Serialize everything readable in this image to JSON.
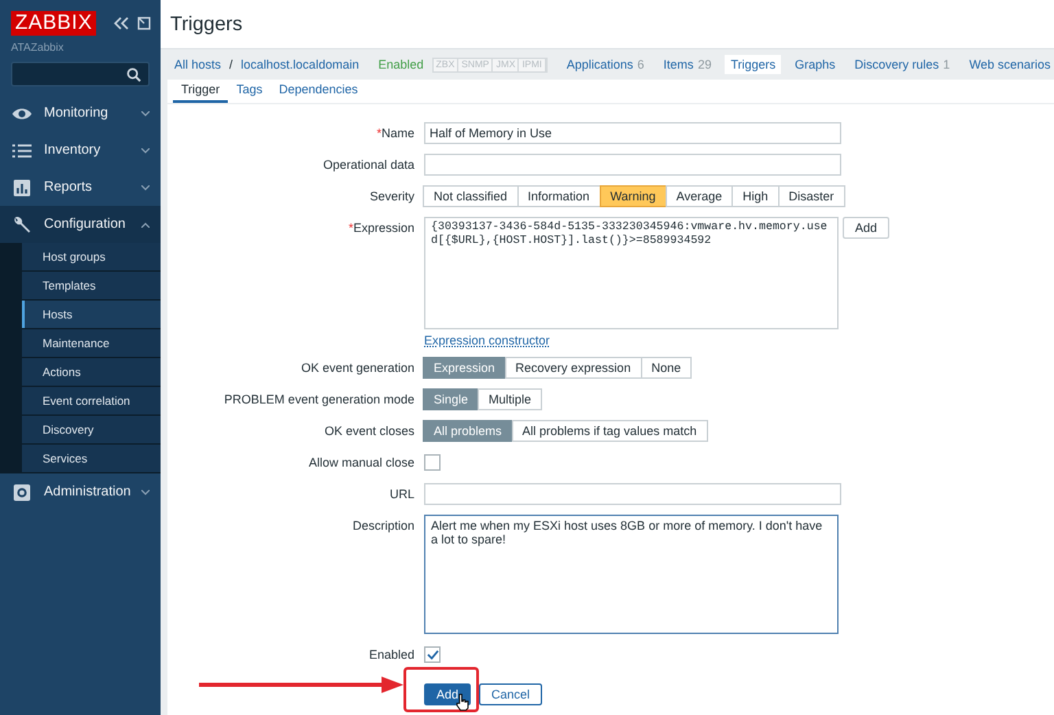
{
  "sidebar": {
    "logo": "ZABBIX",
    "server_name": "ATAZabbix",
    "menu": [
      {
        "label": "Monitoring",
        "expanded": false
      },
      {
        "label": "Inventory",
        "expanded": false
      },
      {
        "label": "Reports",
        "expanded": false
      },
      {
        "label": "Configuration",
        "expanded": true,
        "children": [
          {
            "label": "Host groups",
            "selected": false
          },
          {
            "label": "Templates",
            "selected": false
          },
          {
            "label": "Hosts",
            "selected": true
          },
          {
            "label": "Maintenance",
            "selected": false
          },
          {
            "label": "Actions",
            "selected": false
          },
          {
            "label": "Event correlation",
            "selected": false
          },
          {
            "label": "Discovery",
            "selected": false
          },
          {
            "label": "Services",
            "selected": false
          }
        ]
      },
      {
        "label": "Administration",
        "expanded": false
      }
    ]
  },
  "page_title": "Triggers",
  "breadcrumb": {
    "path": [
      "All hosts",
      "localhost.localdomain"
    ],
    "separator": "/",
    "status": "Enabled",
    "availability": [
      "ZBX",
      "SNMP",
      "JMX",
      "IPMI"
    ],
    "tabs": [
      {
        "label": "Applications",
        "count": "6",
        "selected": false
      },
      {
        "label": "Items",
        "count": "29",
        "selected": false
      },
      {
        "label": "Triggers",
        "selected": true
      },
      {
        "label": "Graphs",
        "selected": false
      },
      {
        "label": "Discovery rules",
        "count": "1",
        "selected": false
      },
      {
        "label": "Web scenarios",
        "selected": false
      }
    ]
  },
  "form_tabs": [
    {
      "label": "Trigger",
      "selected": true
    },
    {
      "label": "Tags",
      "selected": false
    },
    {
      "label": "Dependencies",
      "selected": false
    }
  ],
  "fields": [
    {
      "kind": "text",
      "label": "Name",
      "required_mark": "*",
      "value": "Half of Memory in Use"
    },
    {
      "kind": "text",
      "label": "Operational data"
    },
    {
      "kind": "severity",
      "label": "Severity",
      "options": [
        {
          "label": "Not classified",
          "selected": false
        },
        {
          "label": "Information",
          "selected": false
        },
        {
          "label": "Warning",
          "selected": true
        },
        {
          "label": "Average",
          "selected": false
        },
        {
          "label": "High",
          "selected": false
        },
        {
          "label": "Disaster",
          "selected": false
        }
      ]
    },
    {
      "kind": "expression",
      "label": "Expression",
      "required_mark": "*",
      "value": "{30393137-3436-584d-5135-333230345946:vmware.hv.memory.used[{$URL},{HOST.HOST}].last()}>=8589934592",
      "button": "Add",
      "link": "Expression constructor"
    },
    {
      "kind": "segmented",
      "label": "OK event generation",
      "options": [
        {
          "label": "Expression",
          "selected": true
        },
        {
          "label": "Recovery expression",
          "selected": false
        },
        {
          "label": "None",
          "selected": false
        }
      ]
    },
    {
      "kind": "segmented",
      "label": "PROBLEM event generation mode",
      "options": [
        {
          "label": "Single",
          "selected": true
        },
        {
          "label": "Multiple",
          "selected": false
        }
      ]
    },
    {
      "kind": "segmented",
      "label": "OK event closes",
      "options": [
        {
          "label": "All problems",
          "selected": true
        },
        {
          "label": "All problems if tag values match",
          "selected": false
        }
      ]
    },
    {
      "kind": "checkbox",
      "label": "Allow manual close",
      "checked": false
    },
    {
      "kind": "text",
      "label": "URL"
    },
    {
      "kind": "textarea",
      "label": "Description",
      "value": "Alert me when my ESXi host uses 8GB or more of memory. I don't have a lot to spare!"
    },
    {
      "kind": "checkbox",
      "label": "Enabled",
      "checked": true
    }
  ],
  "actions": [
    {
      "label": "Add",
      "primary": true
    },
    {
      "label": "Cancel",
      "primary": false
    }
  ]
}
